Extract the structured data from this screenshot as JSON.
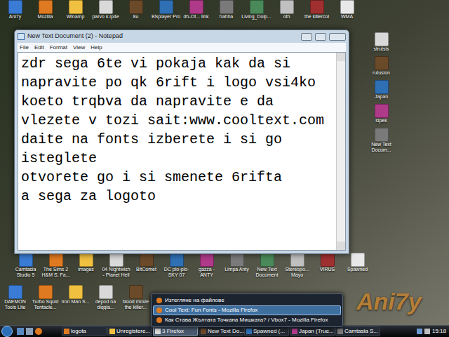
{
  "desktop": {
    "icons_top": [
      "Ani7y",
      "Mozilla",
      "Winamp",
      "parvo k.ip4e",
      "8u",
      "BSplayer Pro",
      "dh-Ot... link",
      "hahha",
      "Living_Dolp...",
      "oth",
      "the killercol",
      "WMA"
    ],
    "icons_right": [
      "strutsis",
      "rutusion",
      "Japan",
      "sipek",
      "New Text Docum..."
    ],
    "icons_middle": [
      "Camtasia Studio 5",
      "The Sims 2 H&M S. Fa...",
      "images",
      "04 Nightwish - Planet Hell",
      "BitComet",
      "DC plo-plo-SKY 07",
      "gazza - ANTY",
      "Limpa Anty",
      "New Text Document",
      "Stereopo... Mayo",
      "VIRUS",
      "Spawned"
    ],
    "icons_bottom": [
      "DAEMON Tools Lite",
      "Turbo Squid Tentacle...",
      "Iron Man S...",
      "depod na diqqla...",
      "blood movie the killer..."
    ],
    "watermark": "Ani7y"
  },
  "notepad": {
    "title": "New Text Document (2) - Notepad",
    "menu": [
      "File",
      "Edit",
      "Format",
      "View",
      "Help"
    ],
    "lines": [
      "zdr sega 6te vi pokaja kak da si",
      "napravite po qk 6rift i logo vsi4ko",
      "koeto trqbva da napravite e da",
      "vlezete v tozi sait:www.cooltext.com",
      "daite na fonts izberete i si go",
      "isteglete",
      "otvorete go i si smenete 6rifta",
      "a sega za logoto"
    ]
  },
  "jump_list": {
    "items": [
      {
        "label": "Изтегляне на файлове",
        "selected": false
      },
      {
        "label": "Cool Text: Fun Fonts - Mozilla Firefox",
        "selected": true
      },
      {
        "label": "Как Става Жълтата Точкана Мишката? / Vbox7 - Mozilla Firefox",
        "selected": false
      }
    ]
  },
  "taskbar": {
    "items": [
      {
        "label": "logota",
        "selected": false
      },
      {
        "label": "Unregistere...",
        "selected": false
      },
      {
        "label": "3 Firefox",
        "selected": true
      },
      {
        "label": "New Text Do...",
        "selected": false
      },
      {
        "label": "Spawned (...",
        "selected": false
      },
      {
        "label": "Japan (True...",
        "selected": false
      },
      {
        "label": "Camtasia S...",
        "selected": false
      }
    ],
    "clock": "15:18"
  }
}
